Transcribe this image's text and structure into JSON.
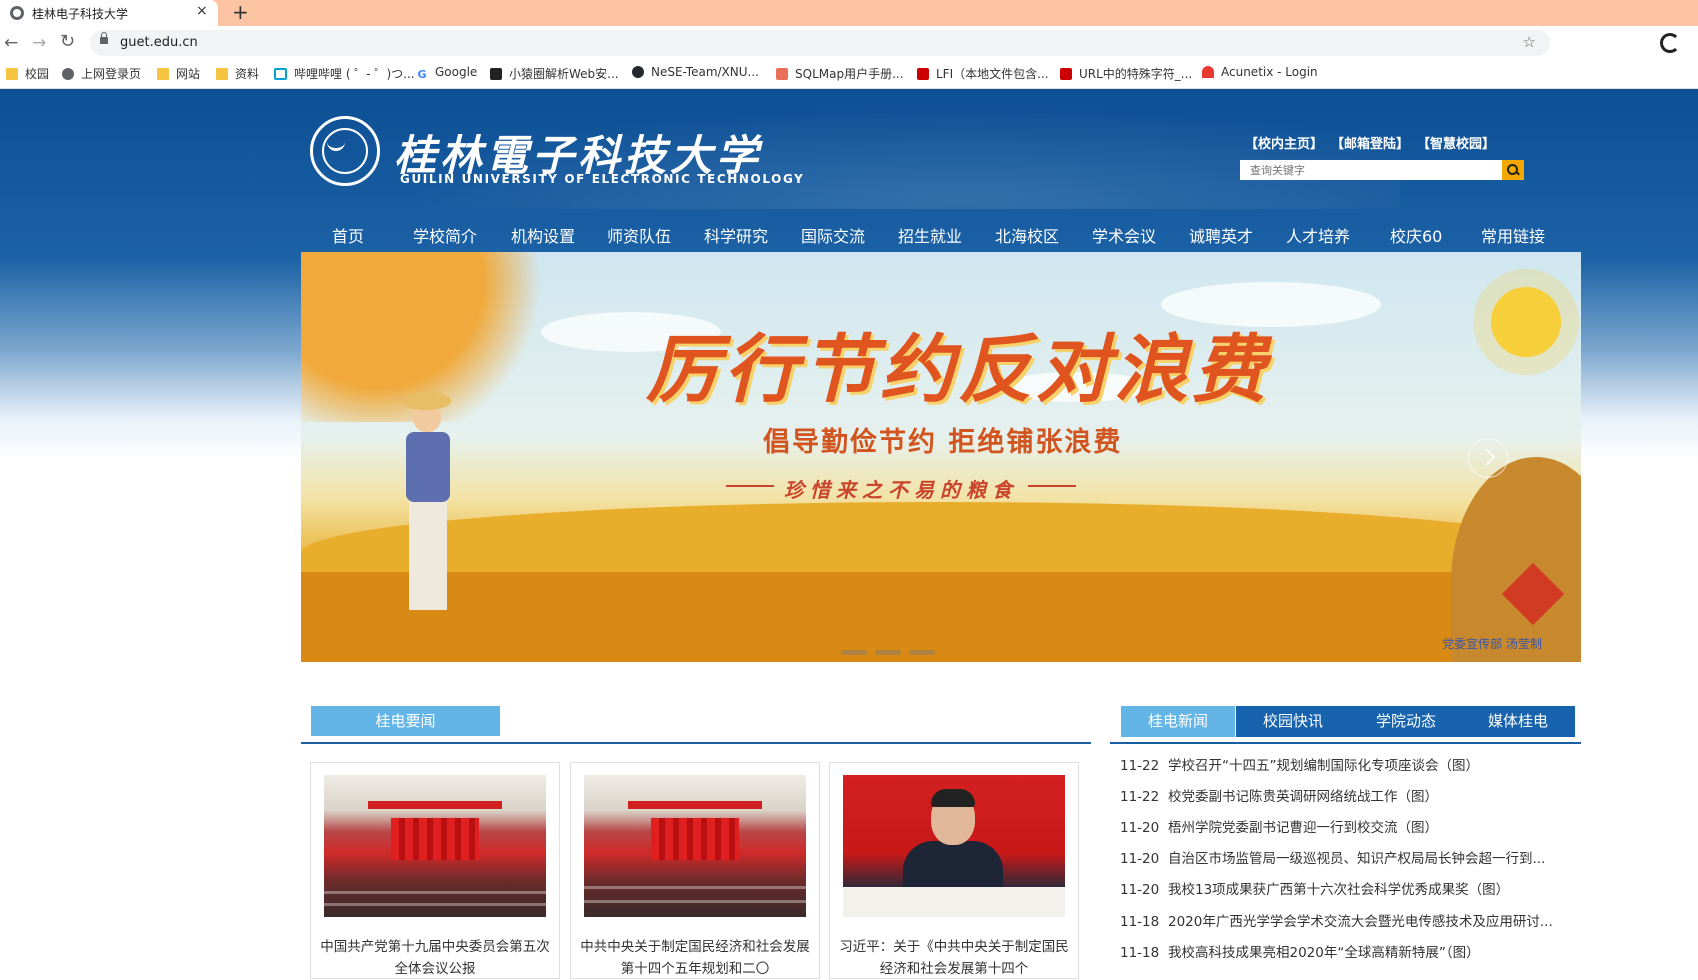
{
  "browser": {
    "tab_title": "桂林电子科技大学",
    "tab_close": "×",
    "new_tab": "+",
    "url": "guet.edu.cn",
    "bookmarks": [
      {
        "label": "校园",
        "icon": "folder-icon"
      },
      {
        "label": "上网登录页",
        "icon": "globe-icon"
      },
      {
        "label": "网站",
        "icon": "folder-icon"
      },
      {
        "label": "资料",
        "icon": "folder-icon"
      },
      {
        "label": "哔哩哔哩 ( ゜- ゜)つ...",
        "icon": "bilibili-icon"
      },
      {
        "label": "Google",
        "icon": "google-icon"
      },
      {
        "label": "小猿圈解析Web安...",
        "icon": "xiaoyuan-icon"
      },
      {
        "label": "NeSE-Team/XNU...",
        "icon": "github-icon"
      },
      {
        "label": "SQLMap用户手册...",
        "icon": "jianshu-icon"
      },
      {
        "label": "LFI（本地文件包含...",
        "icon": "csdn-icon"
      },
      {
        "label": "URL中的特殊字符_...",
        "icon": "csdn-icon"
      },
      {
        "label": "Acunetix - Login",
        "icon": "acunetix-icon"
      }
    ]
  },
  "header": {
    "logo_cn": "桂林電子科技大学",
    "logo_en": "GUILIN UNIVERSITY OF ELECTRONIC TECHNOLOGY",
    "top_links": [
      "【校内主页】",
      "【邮箱登陆】",
      "【智慧校园】"
    ],
    "search_placeholder": "查询关键字"
  },
  "nav": [
    "首页",
    "学校简介",
    "机构设置",
    "师资队伍",
    "科学研究",
    "国际交流",
    "招生就业",
    "北海校区",
    "学术会议",
    "诚聘英才",
    "人才培养",
    "校庆60",
    "常用链接"
  ],
  "banner": {
    "title": "厉行节约反对浪费",
    "subtitle": "倡导勤俭节约  拒绝铺张浪费",
    "tagline": "珍惜来之不易的粮食",
    "credit": "党委宣传部 汤莹制",
    "slides": 3
  },
  "left_section": {
    "tab": "桂电要闻",
    "cards": [
      {
        "caption": "中国共产党第十九届中央委员会第五次全体会议公报"
      },
      {
        "caption": "中共中央关于制定国民经济和社会发展第十四个五年规划和二〇"
      },
      {
        "caption": "习近平：关于《中共中央关于制定国民经济和社会发展第十四个"
      }
    ]
  },
  "right_section": {
    "tabs": [
      "桂电新闻",
      "校园快讯",
      "学院动态",
      "媒体桂电"
    ],
    "active_tab": "桂电新闻",
    "news": [
      {
        "date": "11-22",
        "title": "学校召开“十四五”规划编制国际化专项座谈会（图）"
      },
      {
        "date": "11-22",
        "title": "校党委副书记陈贵英调研网络统战工作（图）"
      },
      {
        "date": "11-20",
        "title": "梧州学院党委副书记曹迎一行到校交流（图）"
      },
      {
        "date": "11-20",
        "title": "自治区市场监管局一级巡视员、知识产权局局长钟会超一行到..."
      },
      {
        "date": "11-20",
        "title": "我校13项成果获广西第十六次社会科学优秀成果奖（图）"
      },
      {
        "date": "11-18",
        "title": "2020年广西光学学会学术交流大会暨光电传感技术及应用研讨..."
      },
      {
        "date": "11-18",
        "title": "我校高科技成果亮相2020年“全球高精新特展”（图）"
      }
    ]
  },
  "colors": {
    "header_blue": "#0d4f94",
    "tab_light_blue": "#63b5e8",
    "tab_dark_blue": "#1763ae",
    "search_button": "#f5a800",
    "tabstrip": "#fcc4a2"
  }
}
